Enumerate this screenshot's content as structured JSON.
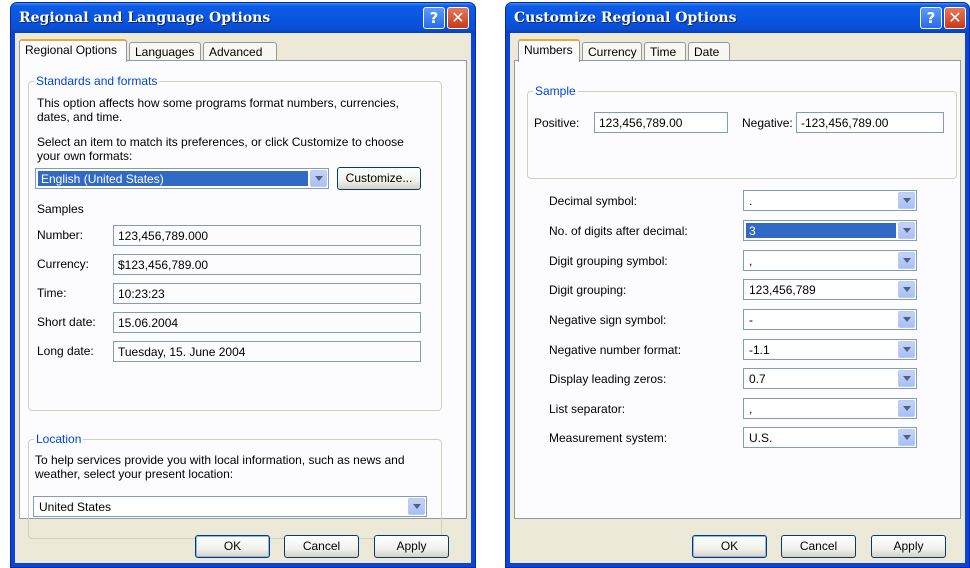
{
  "left_dialog": {
    "title": "Regional and Language Options",
    "tabs": [
      "Regional Options",
      "Languages",
      "Advanced"
    ],
    "standards": {
      "legend": "Standards and formats",
      "description_line1": "This option affects how some programs format numbers, currencies,",
      "description_line2": "dates, and time.",
      "select_line1": "Select an item to match its preferences, or click Customize to choose",
      "select_line2": "your own formats:",
      "selected_locale": "English (United States)",
      "customize_label": "Customize...",
      "samples_heading": "Samples",
      "samples": [
        {
          "label": "Number:",
          "value": "123,456,789.000"
        },
        {
          "label": "Currency:",
          "value": "$123,456,789.00"
        },
        {
          "label": "Time:",
          "value": "10:23:23"
        },
        {
          "label": "Short date:",
          "value": "15.06.2004"
        },
        {
          "label": "Long date:",
          "value": "Tuesday, 15. June 2004"
        }
      ]
    },
    "location": {
      "legend": "Location",
      "description_line1": "To help services provide you with local information, such as news and",
      "description_line2": "weather, select your present location:",
      "selected": "United States"
    },
    "buttons": {
      "ok": "OK",
      "cancel": "Cancel",
      "apply": "Apply"
    }
  },
  "right_dialog": {
    "title": "Customize Regional Options",
    "tabs": [
      "Numbers",
      "Currency",
      "Time",
      "Date"
    ],
    "sample": {
      "legend": "Sample",
      "positive_label": "Positive:",
      "positive_value": "123,456,789.00",
      "negative_label": "Negative:",
      "negative_value": "-123,456,789.00"
    },
    "settings": [
      {
        "label": "Decimal symbol:",
        "value": "."
      },
      {
        "label": "No. of digits after decimal:",
        "value": "3"
      },
      {
        "label": "Digit grouping symbol:",
        "value": ","
      },
      {
        "label": "Digit grouping:",
        "value": "123,456,789"
      },
      {
        "label": "Negative sign symbol:",
        "value": "-"
      },
      {
        "label": "Negative number format:",
        "value": "-1.1"
      },
      {
        "label": "Display leading zeros:",
        "value": "0.7"
      },
      {
        "label": "List separator:",
        "value": ","
      },
      {
        "label": "Measurement system:",
        "value": "U.S."
      }
    ],
    "buttons": {
      "ok": "OK",
      "cancel": "Cancel",
      "apply": "Apply"
    }
  },
  "titlebar_buttons": {
    "help": "?",
    "close": "✕"
  }
}
